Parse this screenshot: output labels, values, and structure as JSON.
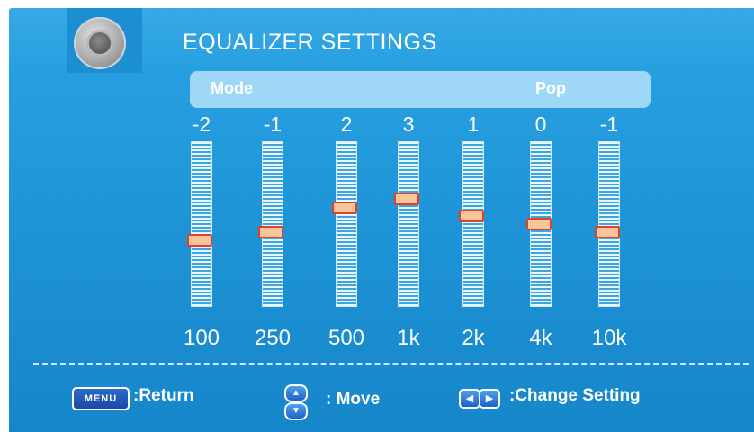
{
  "title": "EQUALIZER SETTINGS",
  "mode": {
    "label": "Mode",
    "value": "Pop"
  },
  "bands": [
    {
      "value": "-2",
      "freq": "100",
      "level": -2
    },
    {
      "value": "-1",
      "freq": "250",
      "level": -1
    },
    {
      "value": "2",
      "freq": "500",
      "level": 2
    },
    {
      "value": "3",
      "freq": "1k",
      "level": 3
    },
    {
      "value": "1",
      "freq": "2k",
      "level": 1
    },
    {
      "value": "0",
      "freq": "4k",
      "level": 0
    },
    {
      "value": "-1",
      "freq": "10k",
      "level": -1
    }
  ],
  "footer": {
    "menu_key": "MENU",
    "return_label": ":Return",
    "move_label": ": Move",
    "change_label": ":Change Setting"
  },
  "colors": {
    "background": "#1d93d6",
    "mode_bar": "#9fd8f6",
    "thumb_fill": "#f7c59b",
    "thumb_border": "#e0412d"
  },
  "icons": {
    "logo": "speaker-icon",
    "menu": "menu-key-icon",
    "move": "up-down-arrows-icon",
    "change": "left-right-arrows-icon"
  }
}
